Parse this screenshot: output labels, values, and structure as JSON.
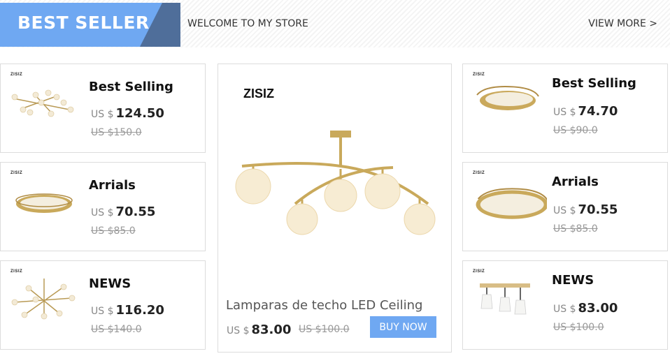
{
  "header": {
    "banner_title": "BEST SELLER",
    "welcome": "WELCOME TO MY STORE",
    "view_more": "VIEW MORE >"
  },
  "colors": {
    "accent": "#6fa8f2",
    "banner_dark": "#4f6e9a",
    "gold": "#c9a95b"
  },
  "left_products": [
    {
      "brand": "ZISIZ",
      "name": "Best Selling",
      "currency": "US $",
      "price": "124.50",
      "old_price": "US $150.0",
      "icon": "branch-chandelier-icon"
    },
    {
      "brand": "ZISIZ",
      "name": "Arrials",
      "currency": "US $",
      "price": "70.55",
      "old_price": "US $85.0",
      "icon": "round-flush-ceiling-light-icon"
    },
    {
      "brand": "ZISIZ",
      "name": "NEWS",
      "currency": "US $",
      "price": "116.20",
      "old_price": "US $140.0",
      "icon": "sputnik-chandelier-icon"
    }
  ],
  "featured": {
    "brand": "ZISIZ",
    "name": "Lamparas de techo LED Ceiling",
    "currency": "US $",
    "price": "83.00",
    "old_price": "US $100.0",
    "buy_label": "BUY NOW",
    "icon": "globe-ceiling-light-icon"
  },
  "right_products": [
    {
      "brand": "ZISIZ",
      "name": "Best Selling",
      "currency": "US $",
      "price": "74.70",
      "old_price": "US $90.0",
      "icon": "ring-ceiling-light-icon"
    },
    {
      "brand": "ZISIZ",
      "name": "Arrials",
      "currency": "US $",
      "price": "70.55",
      "old_price": "US $85.0",
      "icon": "round-flush-ceiling-light-icon"
    },
    {
      "brand": "ZISIZ",
      "name": "NEWS",
      "currency": "US $",
      "price": "83.00",
      "old_price": "US $100.0",
      "icon": "track-spotlight-icon"
    }
  ]
}
